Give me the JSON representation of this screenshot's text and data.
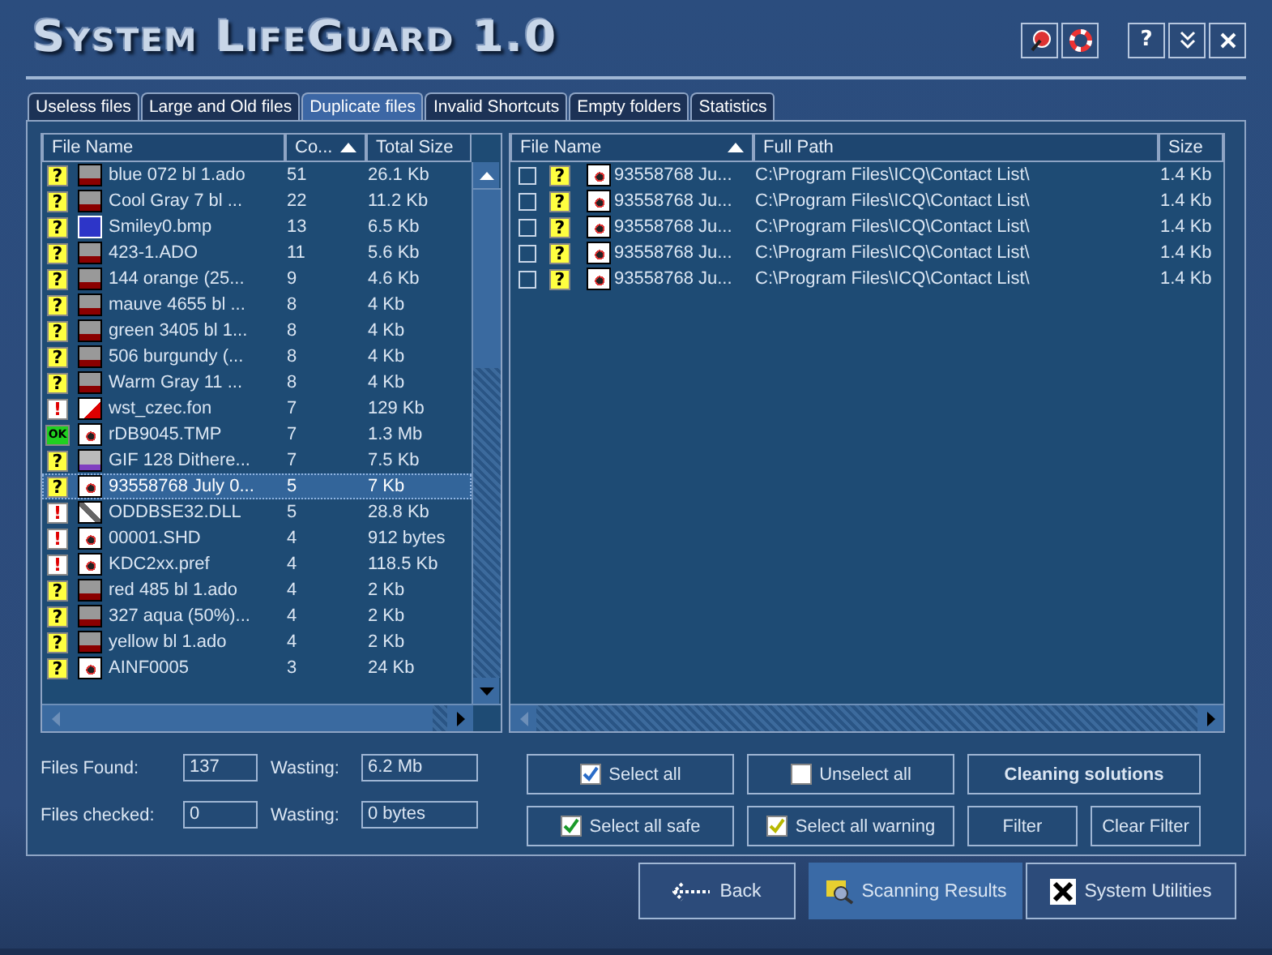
{
  "window": {
    "title": "System LifeGuard 1.0"
  },
  "tabs": [
    {
      "label": "Useless files",
      "selected": false
    },
    {
      "label": "Large and Old files",
      "selected": false
    },
    {
      "label": "Duplicate files",
      "selected": true
    },
    {
      "label": "Invalid Shortcuts",
      "selected": false
    },
    {
      "label": "Empty folders",
      "selected": false
    },
    {
      "label": "Statistics",
      "selected": false
    }
  ],
  "duplicates": {
    "columns": [
      "File Name",
      "Co...",
      "Total Size"
    ],
    "rows": [
      {
        "status": {
          "kind": "question",
          "glyph": "?"
        },
        "icon": {
          "kind": "image"
        },
        "name": "blue 072 bl 1.ado",
        "count": "51",
        "size": "26.1 Kb",
        "selected": false
      },
      {
        "status": {
          "kind": "question",
          "glyph": "?"
        },
        "icon": {
          "kind": "image"
        },
        "name": "Cool Gray 7 bl ...",
        "count": "22",
        "size": "11.2 Kb",
        "selected": false
      },
      {
        "status": {
          "kind": "question",
          "glyph": "?"
        },
        "icon": {
          "kind": "bmp"
        },
        "name": "Smiley0.bmp",
        "count": "13",
        "size": "6.5 Kb",
        "selected": false
      },
      {
        "status": {
          "kind": "question",
          "glyph": "?"
        },
        "icon": {
          "kind": "image"
        },
        "name": "423-1.ADO",
        "count": "11",
        "size": "5.6 Kb",
        "selected": false
      },
      {
        "status": {
          "kind": "question",
          "glyph": "?"
        },
        "icon": {
          "kind": "image"
        },
        "name": "144 orange (25...",
        "count": "9",
        "size": "4.6 Kb",
        "selected": false
      },
      {
        "status": {
          "kind": "question",
          "glyph": "?"
        },
        "icon": {
          "kind": "image"
        },
        "name": "mauve 4655 bl ...",
        "count": "8",
        "size": "4 Kb",
        "selected": false
      },
      {
        "status": {
          "kind": "question",
          "glyph": "?"
        },
        "icon": {
          "kind": "image"
        },
        "name": "green 3405 bl 1...",
        "count": "8",
        "size": "4 Kb",
        "selected": false
      },
      {
        "status": {
          "kind": "question",
          "glyph": "?"
        },
        "icon": {
          "kind": "image"
        },
        "name": "506 burgundy (...",
        "count": "8",
        "size": "4 Kb",
        "selected": false
      },
      {
        "status": {
          "kind": "question",
          "glyph": "?"
        },
        "icon": {
          "kind": "image"
        },
        "name": "Warm Gray 11 ...",
        "count": "8",
        "size": "4 Kb",
        "selected": false
      },
      {
        "status": {
          "kind": "warning",
          "glyph": "!"
        },
        "icon": {
          "kind": "font"
        },
        "name": "wst_czec.fon",
        "count": "7",
        "size": "129 Kb",
        "selected": false
      },
      {
        "status": {
          "kind": "ok",
          "glyph": "OK"
        },
        "icon": {
          "kind": "doc"
        },
        "name": "rDB9045.TMP",
        "count": "7",
        "size": "1.3 Mb",
        "selected": false
      },
      {
        "status": {
          "kind": "question",
          "glyph": "?"
        },
        "icon": {
          "kind": "gif"
        },
        "name": "GIF 128 Dithere...",
        "count": "7",
        "size": "7.5 Kb",
        "selected": false
      },
      {
        "status": {
          "kind": "question",
          "glyph": "?"
        },
        "icon": {
          "kind": "doc"
        },
        "name": "93558768 July 0...",
        "count": "5",
        "size": "7 Kb",
        "selected": true
      },
      {
        "status": {
          "kind": "warning",
          "glyph": "!"
        },
        "icon": {
          "kind": "dll"
        },
        "name": "ODDBSE32.DLL",
        "count": "5",
        "size": "28.8 Kb",
        "selected": false
      },
      {
        "status": {
          "kind": "warning",
          "glyph": "!"
        },
        "icon": {
          "kind": "doc"
        },
        "name": "00001.SHD",
        "count": "4",
        "size": "912 bytes",
        "selected": false
      },
      {
        "status": {
          "kind": "warning",
          "glyph": "!"
        },
        "icon": {
          "kind": "doc"
        },
        "name": "KDC2xx.pref",
        "count": "4",
        "size": "118.5 Kb",
        "selected": false
      },
      {
        "status": {
          "kind": "question",
          "glyph": "?"
        },
        "icon": {
          "kind": "image"
        },
        "name": "red 485 bl 1.ado",
        "count": "4",
        "size": "2 Kb",
        "selected": false
      },
      {
        "status": {
          "kind": "question",
          "glyph": "?"
        },
        "icon": {
          "kind": "image"
        },
        "name": "327 aqua (50%)...",
        "count": "4",
        "size": "2 Kb",
        "selected": false
      },
      {
        "status": {
          "kind": "question",
          "glyph": "?"
        },
        "icon": {
          "kind": "image"
        },
        "name": "yellow bl 1.ado",
        "count": "4",
        "size": "2 Kb",
        "selected": false
      },
      {
        "status": {
          "kind": "question",
          "glyph": "?"
        },
        "icon": {
          "kind": "doc"
        },
        "name": "AINF0005",
        "count": "3",
        "size": "24 Kb",
        "selected": false
      }
    ]
  },
  "copies": {
    "columns": [
      "File Name",
      "Full Path",
      "Size"
    ],
    "rows": [
      {
        "checked": false,
        "status": {
          "kind": "question",
          "glyph": "?"
        },
        "icon": {
          "kind": "doc"
        },
        "name": "93558768 Ju...",
        "path": "C:\\Program Files\\ICQ\\Contact List\\",
        "size": "1.4 Kb"
      },
      {
        "checked": false,
        "status": {
          "kind": "question",
          "glyph": "?"
        },
        "icon": {
          "kind": "doc"
        },
        "name": "93558768 Ju...",
        "path": "C:\\Program Files\\ICQ\\Contact List\\",
        "size": "1.4 Kb"
      },
      {
        "checked": false,
        "status": {
          "kind": "question",
          "glyph": "?"
        },
        "icon": {
          "kind": "doc"
        },
        "name": "93558768 Ju...",
        "path": "C:\\Program Files\\ICQ\\Contact List\\",
        "size": "1.4 Kb"
      },
      {
        "checked": false,
        "status": {
          "kind": "question",
          "glyph": "?"
        },
        "icon": {
          "kind": "doc"
        },
        "name": "93558768 Ju...",
        "path": "C:\\Program Files\\ICQ\\Contact List\\",
        "size": "1.4 Kb"
      },
      {
        "checked": false,
        "status": {
          "kind": "question",
          "glyph": "?"
        },
        "icon": {
          "kind": "doc"
        },
        "name": "93558768 Ju...",
        "path": "C:\\Program Files\\ICQ\\Contact List\\",
        "size": "1.4 Kb"
      }
    ]
  },
  "stats": [
    {
      "label": "Files Found:",
      "value": "137",
      "wasting_label": "Wasting:",
      "wasting": "6.2 Mb"
    },
    {
      "label": "Files checked:",
      "value": "0",
      "wasting_label": "Wasting:",
      "wasting": "0 bytes"
    }
  ],
  "actions": [
    {
      "label": "Select all",
      "kind": "check-blue"
    },
    {
      "label": "Unselect all",
      "kind": "check-empty"
    },
    {
      "label": "Cleaning solutions",
      "kind": "wide"
    },
    {
      "label": "Select all safe",
      "kind": "check-green"
    },
    {
      "label": "Select all warning",
      "kind": "check-yellow"
    },
    {
      "label": "Filter",
      "kind": "plain"
    },
    {
      "label": "Clear Filter",
      "kind": "plain"
    }
  ],
  "nav": [
    {
      "label": "Back",
      "kind": "back",
      "selected": false
    },
    {
      "label": "Scanning Results",
      "kind": "results",
      "selected": true
    },
    {
      "label": "System Utilities",
      "kind": "utilities",
      "selected": false
    }
  ],
  "title_buttons": [
    "?"
  ]
}
